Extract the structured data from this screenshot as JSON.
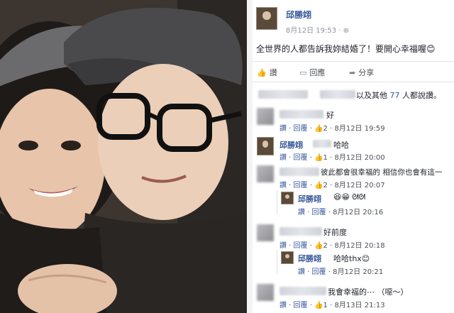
{
  "post": {
    "author": "邱勝翊",
    "date": "8月12日",
    "time": "19:53",
    "audience_icon": "globe-icon",
    "text": "全世界的人都告訴我妳結婚了！要開心幸福喔😊"
  },
  "actions": {
    "like": "讚",
    "comment": "回應",
    "share": "分享"
  },
  "likes_summary": {
    "prefix": "以及其他",
    "count": "77",
    "suffix": "人都說讚。"
  },
  "comments": [
    {
      "text": "好",
      "like": "讚",
      "reply": "回覆",
      "likes": "2",
      "date": "8月12日",
      "time": "19:59"
    },
    {
      "author": "邱勝翊",
      "text": "哈哈",
      "like": "讚",
      "reply": "回覆",
      "likes": "1",
      "date": "8月12日",
      "time": "20:00"
    },
    {
      "text": "彼此都會很幸福的 相信你也會有這一",
      "like": "讚",
      "reply": "回覆",
      "likes": "2",
      "date": "8月12日",
      "time": "20:07",
      "reply_item": {
        "author": "邱勝翊",
        "text": "😆😁 ᘛᘛ",
        "like": "讚",
        "reply": "回覆",
        "date": "8月12日",
        "time": "20:16"
      }
    },
    {
      "text": "好前度",
      "like": "讚",
      "reply": "回覆",
      "likes": "2",
      "date": "8月12日",
      "time": "20:18",
      "reply_item": {
        "author": "邱勝翊",
        "text": "哈哈thx😊",
        "like": "讚",
        "reply": "回覆",
        "date": "8月12日",
        "time": "20:21"
      }
    },
    {
      "text": "我會幸福的⋯ （噁～）",
      "like": "讚",
      "reply": "回覆",
      "likes": "1",
      "date": "8月13日",
      "time": "21:13"
    }
  ],
  "colors": {
    "link": "#365899",
    "text": "#1d2129",
    "meta": "#4b4f56"
  }
}
